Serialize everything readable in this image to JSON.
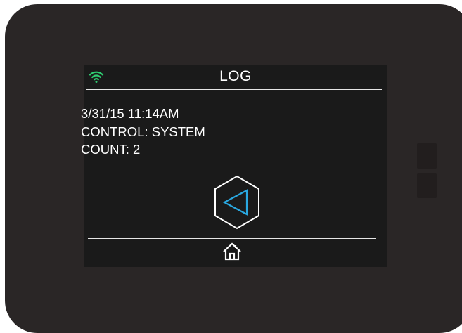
{
  "screen": {
    "title": "LOG"
  },
  "log_entry": {
    "timestamp": "3/31/15 11:14AM",
    "control": "CONTROL: SYSTEM",
    "count": "COUNT: 2"
  },
  "icons": {
    "status": "wifi-icon",
    "back": "back-arrow-icon",
    "home": "home-icon"
  },
  "colors": {
    "wifi": "#2ecc71",
    "back_arrow": "#2aa8e0",
    "text": "#ffffff",
    "screen_bg": "#1a1a1a",
    "bezel": "#2a2626"
  }
}
